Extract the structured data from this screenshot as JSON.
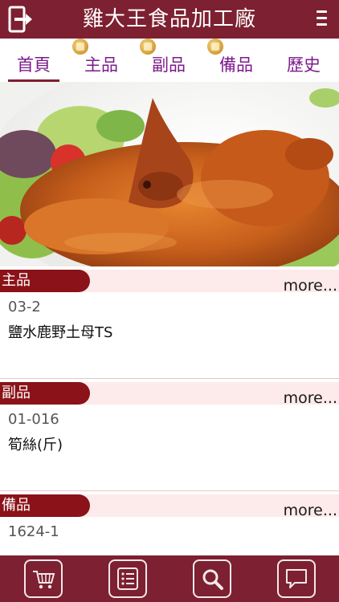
{
  "header": {
    "title": "雞大王食品加工廠",
    "exit_icon": "exit-icon",
    "menu_icon": "hamburger-menu-icon",
    "color": "#7d2031"
  },
  "tabs": [
    {
      "label": "首頁",
      "active": true,
      "badge": false
    },
    {
      "label": "主品",
      "active": false,
      "badge": true
    },
    {
      "label": "副品",
      "active": false,
      "badge": true
    },
    {
      "label": "備品",
      "active": false,
      "badge": true
    },
    {
      "label": "歷史",
      "active": false,
      "badge": false
    }
  ],
  "hero": {
    "image": "roast-chicken-photo"
  },
  "sections": [
    {
      "title": "主品",
      "more_label": "more...",
      "code": "03-2",
      "name": "鹽水鹿野土母TS"
    },
    {
      "title": "副品",
      "more_label": "more...",
      "code": "01-016",
      "name": "筍絲(斤)"
    },
    {
      "title": "備品",
      "more_label": "more...",
      "code": "1624-1",
      "name": ""
    }
  ],
  "bottom_nav": [
    {
      "icon": "cart-icon"
    },
    {
      "icon": "list-icon"
    },
    {
      "icon": "search-icon"
    },
    {
      "icon": "chat-icon"
    }
  ],
  "colors": {
    "brand": "#7d2031",
    "pill": "#8a1218",
    "tab_text": "#7d1a8c",
    "section_bar": "#fdeaea"
  }
}
